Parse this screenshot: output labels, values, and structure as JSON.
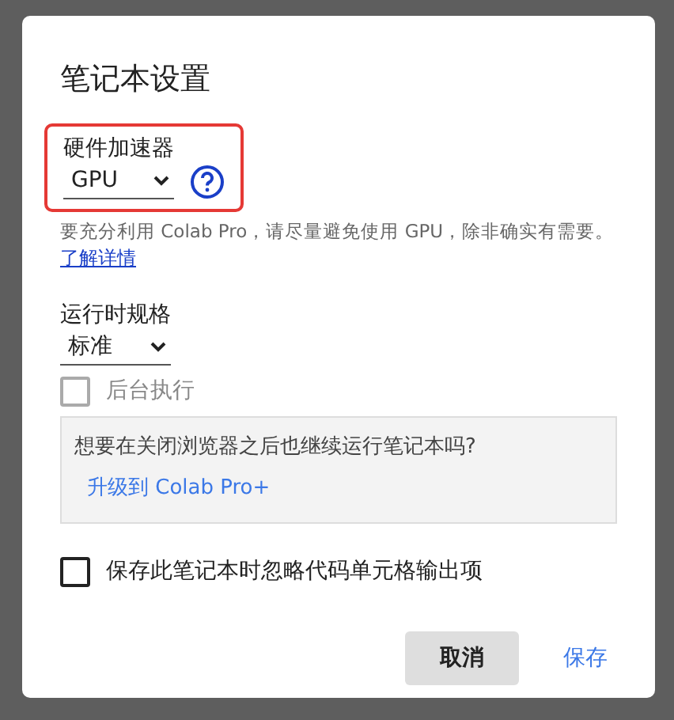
{
  "dialog": {
    "title": "笔记本设置"
  },
  "accelerator": {
    "label": "硬件加速器",
    "value": "GPU",
    "highlighted": true
  },
  "hint": "要充分利用 Colab Pro，请尽量避免使用 GPU，除非确实有需要。",
  "learn_more": "了解详情",
  "runtime_shape": {
    "label": "运行时规格",
    "value": "标准"
  },
  "background_execution": {
    "label": "后台执行",
    "checked": false,
    "disabled": true
  },
  "upsell": {
    "text": "想要在关闭浏览器之后也继续运行笔记本吗?",
    "link": "升级到 Colab Pro+"
  },
  "omit_output": {
    "label": "保存此笔记本时忽略代码单元格输出项",
    "checked": false,
    "disabled": false
  },
  "buttons": [
    {
      "label": "取消",
      "kind": "secondary"
    },
    {
      "label": "保存",
      "kind": "primary"
    }
  ]
}
